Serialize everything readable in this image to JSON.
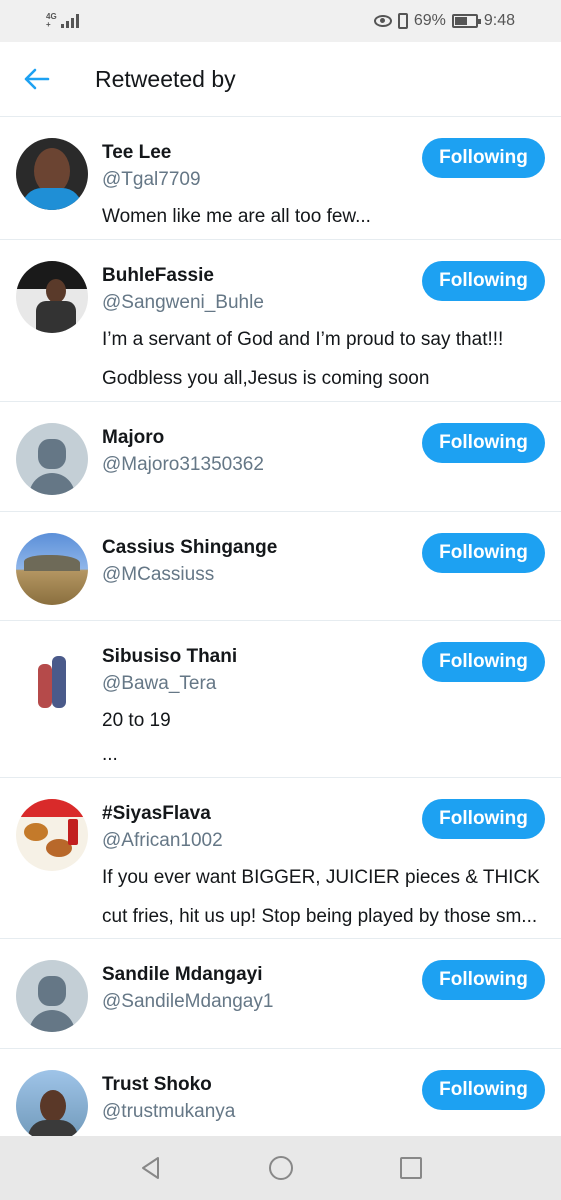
{
  "status_bar": {
    "network": "4G",
    "network_sub": "+",
    "battery_percent": "69%",
    "time": "9:48"
  },
  "header": {
    "title": "Retweeted by",
    "back_icon": "arrow-left-icon"
  },
  "colors": {
    "accent": "#1da1f2",
    "name_text": "#14171a",
    "handle_text": "#657786"
  },
  "users": [
    {
      "name": "Tee Lee",
      "handle": "@Tgal7709",
      "bio": [
        "Women like me are all too few..."
      ],
      "button": "Following"
    },
    {
      "name": "BuhleFassie",
      "handle": "@Sangweni_Buhle",
      "bio": [
        "I’m a servant of God and I’m proud to say that!!!",
        "Godbless you all,Jesus is coming soon"
      ],
      "button": "Following"
    },
    {
      "name": "Majoro",
      "handle": "@Majoro31350362",
      "bio": [],
      "button": "Following"
    },
    {
      "name": "Cassius Shingange",
      "handle": "@MCassiuss",
      "bio": [],
      "button": "Following"
    },
    {
      "name": "Sibusiso Thani",
      "handle": "@Bawa_Tera",
      "bio": [
        "20 to 19",
        "..."
      ],
      "button": "Following"
    },
    {
      "name": "#SiyasFlava",
      "handle": "@African1002",
      "bio": [
        "If you ever want BIGGER, JUICIER pieces & THICK",
        "cut fries, hit us up! Stop being played by those sm..."
      ],
      "button": "Following"
    },
    {
      "name": "Sandile Mdangayi",
      "handle": "@SandileMdangay1",
      "bio": [],
      "button": "Following"
    },
    {
      "name": "Trust Shoko",
      "handle": "@trustmukanya",
      "bio": [],
      "button": "Following"
    }
  ],
  "nav": {
    "back": "triangle-back-icon",
    "home": "circle-home-icon",
    "recents": "square-recents-icon"
  }
}
